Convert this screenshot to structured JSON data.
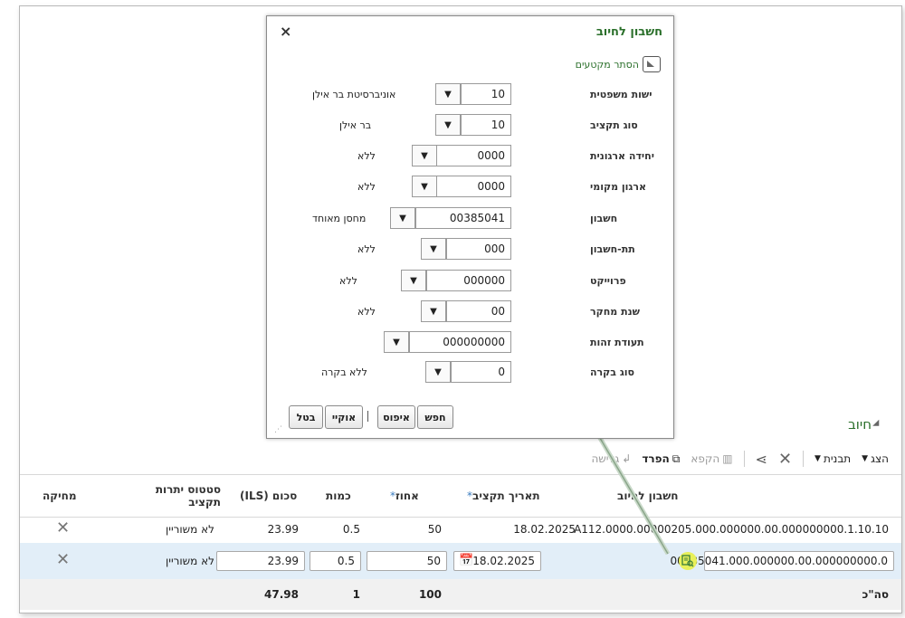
{
  "section": {
    "title": "חיוב"
  },
  "toolbar": {
    "view": "הצג",
    "template": "תבנית",
    "freeze": "הקפא",
    "detach": "הפרד",
    "wrap": "גלישה"
  },
  "grid": {
    "headers": {
      "account": "חשבון לחיוב",
      "budget_date": "תאריך תקציב",
      "percent": "אחוז",
      "quantity": "כמות",
      "amount": "סכום (ILS)",
      "budget_status": "סטטוס יתרות תקציב",
      "delete": "מחיקה"
    },
    "rows": [
      {
        "account": "A112.0000.00000205.000.000000.00.000000000.1.10.10",
        "budget_date": "18.02.2025",
        "percent": "50",
        "quantity": "0.5",
        "amount": "23.99",
        "budget_status": "לא משוריין"
      },
      {
        "account": "00385041.000.000000.00.000000000.0",
        "budget_date": "18.02.2025",
        "percent": "50",
        "quantity": "0.5",
        "amount": "23.99",
        "budget_status": "לא משוריין"
      }
    ],
    "totals": {
      "label": "סה\"כ",
      "percent": "100",
      "quantity": "1",
      "amount": "47.98"
    }
  },
  "dialog": {
    "title": "חשבון לחיוב",
    "close": "×",
    "hide_segments": "הסתר מקטעים",
    "fields": [
      {
        "label": "ישות משפטית",
        "value": "10",
        "desc": "אוניברסיטת בר אילן"
      },
      {
        "label": "סוג תקציב",
        "value": "10",
        "desc": "בר אילן"
      },
      {
        "label": "יחידה ארגונית",
        "value": "0000",
        "desc": "ללא"
      },
      {
        "label": "ארגון מקומי",
        "value": "0000",
        "desc": "ללא"
      },
      {
        "label": "חשבון",
        "value": "00385041",
        "desc": "מחסן מאוחד"
      },
      {
        "label": "תת-חשבון",
        "value": "000",
        "desc": "ללא"
      },
      {
        "label": "פרוייקט",
        "value": "000000",
        "desc": "ללא"
      },
      {
        "label": "שנת מחקר",
        "value": "00",
        "desc": "ללא"
      },
      {
        "label": "תעודת זהות",
        "value": "000000000",
        "desc": ""
      },
      {
        "label": "סוג בקרה",
        "value": "0",
        "desc": "ללא בקרה"
      }
    ],
    "buttons": {
      "search": "חפש",
      "reset": "איפוס",
      "ok": "אוקיי",
      "cancel": "בטל"
    }
  }
}
